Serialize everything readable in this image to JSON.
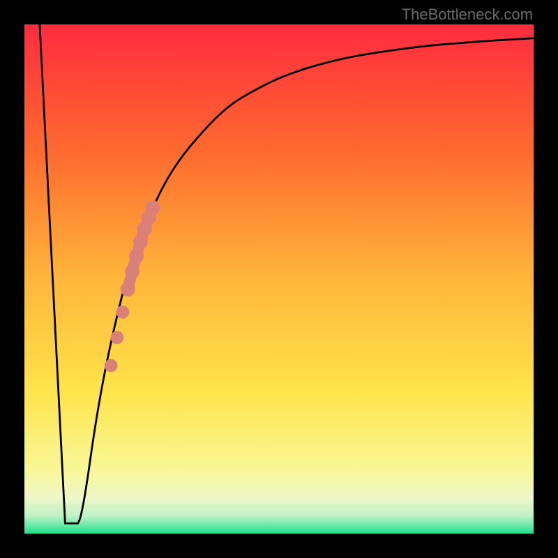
{
  "watermark": "TheBottleneck.com",
  "colors": {
    "bg_black": "#000000",
    "curve": "#000000",
    "dot_fill": "#d98079",
    "gradient_stops": [
      {
        "offset": 0,
        "color": "#ff2b3f"
      },
      {
        "offset": 0.25,
        "color": "#ff6a2f"
      },
      {
        "offset": 0.5,
        "color": "#ffb63a"
      },
      {
        "offset": 0.72,
        "color": "#ffe44a"
      },
      {
        "offset": 0.88,
        "color": "#f7f79a"
      },
      {
        "offset": 0.93,
        "color": "#eef7c8"
      },
      {
        "offset": 0.965,
        "color": "#bff2c5"
      },
      {
        "offset": 1.0,
        "color": "#1ee08a"
      }
    ]
  },
  "chart_data": {
    "type": "line",
    "title": "",
    "xlabel": "",
    "ylabel": "",
    "xlim": [
      0,
      100
    ],
    "ylim": [
      0,
      100
    ],
    "series": [
      {
        "name": "bottleneck-curve",
        "x": [
          3,
          8,
          9,
          10,
          11,
          12,
          14,
          16,
          18,
          20,
          22,
          26,
          30,
          35,
          40,
          45,
          50,
          55,
          60,
          65,
          70,
          75,
          80,
          85,
          90,
          95,
          100
        ],
        "values": [
          100,
          3,
          2,
          2,
          3,
          8,
          22,
          33,
          42,
          50,
          56,
          66,
          73,
          79,
          84,
          87,
          89.5,
          91.3,
          92.7,
          93.8,
          94.6,
          95.3,
          95.9,
          96.3,
          96.7,
          97.0,
          97.3
        ]
      }
    ],
    "flat_bottom": {
      "x_start": 8,
      "x_end": 10.5,
      "y": 2
    },
    "highlight_band": {
      "name": "highlight-dots",
      "points": [
        {
          "x": 17.0,
          "y": 33.0,
          "r": 1.2
        },
        {
          "x": 18.2,
          "y": 38.5,
          "r": 1.2
        },
        {
          "x": 19.3,
          "y": 43.5,
          "r": 1.2
        },
        {
          "x": 20.3,
          "y": 48.0,
          "r": 1.5
        },
        {
          "x": 21.2,
          "y": 51.5,
          "r": 1.5
        },
        {
          "x": 22.0,
          "y": 54.5,
          "r": 1.5
        },
        {
          "x": 22.8,
          "y": 57.3,
          "r": 1.5
        },
        {
          "x": 23.6,
          "y": 59.8,
          "r": 1.5
        },
        {
          "x": 24.4,
          "y": 62.0,
          "r": 1.5
        },
        {
          "x": 25.2,
          "y": 64.0,
          "r": 1.5
        }
      ]
    }
  }
}
